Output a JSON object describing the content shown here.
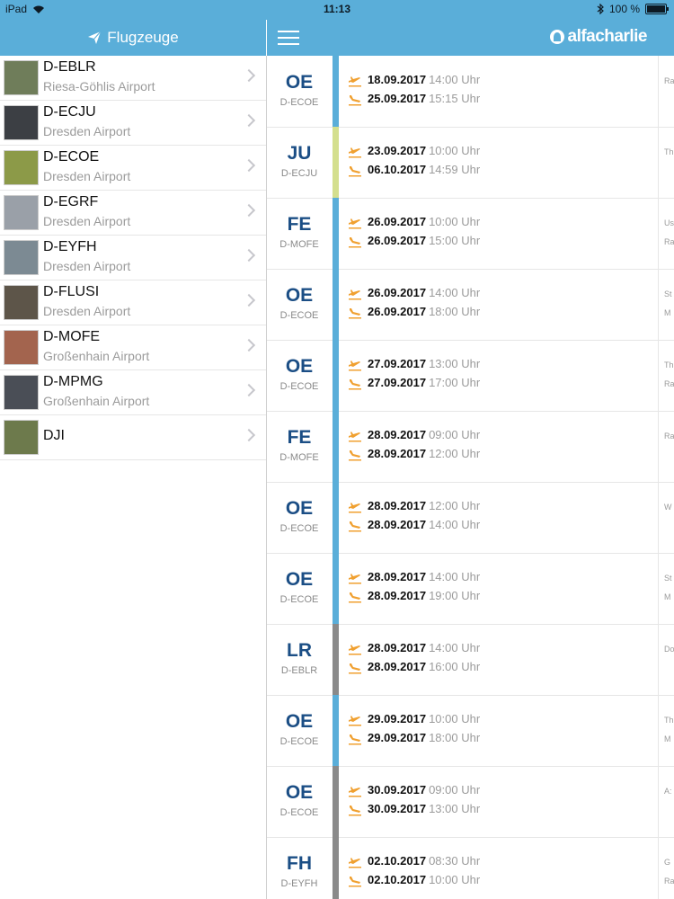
{
  "status": {
    "device": "iPad",
    "time": "11:13",
    "battery": "100 %",
    "battery_level": 1.0
  },
  "sidebar": {
    "title": "Flugzeuge",
    "aircraft": [
      {
        "reg": "D-EBLR",
        "airport": "Riesa-Göhlis Airport",
        "thumb_color": "#6f7d5a"
      },
      {
        "reg": "D-ECJU",
        "airport": "Dresden Airport",
        "thumb_color": "#3c3f44"
      },
      {
        "reg": "D-ECOE",
        "airport": "Dresden Airport",
        "thumb_color": "#8c9a48"
      },
      {
        "reg": "D-EGRF",
        "airport": "Dresden Airport",
        "thumb_color": "#9aa0a8"
      },
      {
        "reg": "D-EYFH",
        "airport": "Dresden Airport",
        "thumb_color": "#7c8a93"
      },
      {
        "reg": "D-FLUSI",
        "airport": "Dresden Airport",
        "thumb_color": "#5d5549"
      },
      {
        "reg": "D-MOFE",
        "airport": "Großenhain Airport",
        "thumb_color": "#a3644e"
      },
      {
        "reg": "D-MPMG",
        "airport": "Großenhain Airport",
        "thumb_color": "#4a4e56"
      },
      {
        "reg": "DJI",
        "airport": "",
        "thumb_color": "#6d7a4c"
      }
    ]
  },
  "header": {
    "logo_text": "alfacharlie"
  },
  "colors": {
    "blue": "#5aaed9",
    "green": "#d4df8e",
    "gray": "#8a8a8a",
    "code": "#1b4e85",
    "plane": "#f0a030"
  },
  "bookings": [
    {
      "code": "OE",
      "reg": "D-ECOE",
      "bar": "blue",
      "dep_date": "18.09.2017",
      "dep_time": "14:00 Uhr",
      "arr_date": "25.09.2017",
      "arr_time": "15:15 Uhr",
      "note1": "Ra",
      "note2": ""
    },
    {
      "code": "JU",
      "reg": "D-ECJU",
      "bar": "green",
      "dep_date": "23.09.2017",
      "dep_time": "10:00 Uhr",
      "arr_date": "06.10.2017",
      "arr_time": "14:59 Uhr",
      "note1": "Th",
      "note2": ""
    },
    {
      "code": "FE",
      "reg": "D-MOFE",
      "bar": "blue",
      "dep_date": "26.09.2017",
      "dep_time": "10:00 Uhr",
      "arr_date": "26.09.2017",
      "arr_time": "15:00 Uhr",
      "note1": "Us",
      "note2": "Ra"
    },
    {
      "code": "OE",
      "reg": "D-ECOE",
      "bar": "blue",
      "dep_date": "26.09.2017",
      "dep_time": "14:00 Uhr",
      "arr_date": "26.09.2017",
      "arr_time": "18:00 Uhr",
      "note1": "St",
      "note2": "M"
    },
    {
      "code": "OE",
      "reg": "D-ECOE",
      "bar": "blue",
      "dep_date": "27.09.2017",
      "dep_time": "13:00 Uhr",
      "arr_date": "27.09.2017",
      "arr_time": "17:00 Uhr",
      "note1": "Th",
      "note2": "Ra"
    },
    {
      "code": "FE",
      "reg": "D-MOFE",
      "bar": "blue",
      "dep_date": "28.09.2017",
      "dep_time": "09:00 Uhr",
      "arr_date": "28.09.2017",
      "arr_time": "12:00 Uhr",
      "note1": "Ra",
      "note2": ""
    },
    {
      "code": "OE",
      "reg": "D-ECOE",
      "bar": "blue",
      "dep_date": "28.09.2017",
      "dep_time": "12:00 Uhr",
      "arr_date": "28.09.2017",
      "arr_time": "14:00 Uhr",
      "note1": "W",
      "note2": ""
    },
    {
      "code": "OE",
      "reg": "D-ECOE",
      "bar": "blue",
      "dep_date": "28.09.2017",
      "dep_time": "14:00 Uhr",
      "arr_date": "28.09.2017",
      "arr_time": "19:00 Uhr",
      "note1": "St",
      "note2": "M"
    },
    {
      "code": "LR",
      "reg": "D-EBLR",
      "bar": "gray",
      "dep_date": "28.09.2017",
      "dep_time": "14:00 Uhr",
      "arr_date": "28.09.2017",
      "arr_time": "16:00 Uhr",
      "note1": "Do",
      "note2": ""
    },
    {
      "code": "OE",
      "reg": "D-ECOE",
      "bar": "blue",
      "dep_date": "29.09.2017",
      "dep_time": "10:00 Uhr",
      "arr_date": "29.09.2017",
      "arr_time": "18:00 Uhr",
      "note1": "Th",
      "note2": "M"
    },
    {
      "code": "OE",
      "reg": "D-ECOE",
      "bar": "gray",
      "dep_date": "30.09.2017",
      "dep_time": "09:00 Uhr",
      "arr_date": "30.09.2017",
      "arr_time": "13:00 Uhr",
      "note1": "A:",
      "note2": ""
    },
    {
      "code": "FH",
      "reg": "D-EYFH",
      "bar": "gray",
      "dep_date": "02.10.2017",
      "dep_time": "08:30 Uhr",
      "arr_date": "02.10.2017",
      "arr_time": "10:00 Uhr",
      "note1": "G",
      "note2": "Ra"
    }
  ]
}
